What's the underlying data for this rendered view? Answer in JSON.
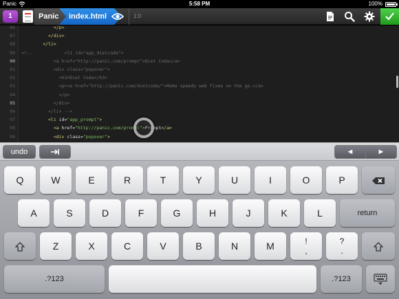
{
  "status_bar": {
    "carrier": "Panic",
    "time": "5:58 PM",
    "battery": "100%"
  },
  "toolbar": {
    "badge": "1",
    "site_name": "Panic",
    "file_name": "index.html",
    "cursor_position": "1:0",
    "accent_color": "#1a6fd1",
    "commit_color": "#2eb82b"
  },
  "editor": {
    "lines": [
      {
        "num": "86",
        "active": false,
        "indent": 12,
        "tokens": [
          [
            "tag",
            "</p>"
          ]
        ]
      },
      {
        "num": "87",
        "active": false,
        "indent": 10,
        "tokens": [
          [
            "tag",
            "</div>"
          ]
        ]
      },
      {
        "num": "88",
        "active": false,
        "indent": 8,
        "tokens": [
          [
            "tag",
            "</li>"
          ]
        ]
      },
      {
        "num": "89",
        "active": false,
        "indent": 0,
        "tokens": [
          [
            "cmt",
            "<!--"
          ],
          [
            "cmt",
            "            <li id=\"app_dietcoda\">"
          ]
        ]
      },
      {
        "num": "90",
        "active": true,
        "indent": 12,
        "tokens": [
          [
            "cmt",
            "<a href=\"http://panic.com/prompt\">Diet Coda</a>"
          ]
        ]
      },
      {
        "num": "91",
        "active": false,
        "indent": 12,
        "tokens": [
          [
            "cmt",
            "<div class=\"popover\">"
          ]
        ]
      },
      {
        "num": "92",
        "active": false,
        "indent": 14,
        "tokens": [
          [
            "cmt",
            "<h3>Diet Coda</h3>"
          ]
        ]
      },
      {
        "num": "93",
        "active": false,
        "indent": 14,
        "tokens": [
          [
            "cmt",
            "<p><a href=\"http://panic.com/dietcoda/\">Make speedy web fixes on the go.</a>"
          ]
        ]
      },
      {
        "num": "94",
        "active": false,
        "indent": 14,
        "tokens": [
          [
            "cmt",
            "</p>"
          ]
        ]
      },
      {
        "num": "95",
        "active": true,
        "indent": 12,
        "tokens": [
          [
            "cmt",
            "</div>"
          ]
        ]
      },
      {
        "num": "96",
        "active": false,
        "indent": 10,
        "tokens": [
          [
            "cmt",
            "</li> -->"
          ]
        ]
      },
      {
        "num": "97",
        "active": false,
        "indent": 10,
        "tokens": [
          [
            "tag",
            "<li "
          ],
          [
            "attr",
            "id="
          ],
          [
            "str",
            "\"app_prompt\""
          ],
          [
            "tag",
            ">"
          ]
        ]
      },
      {
        "num": "98",
        "active": false,
        "indent": 12,
        "tokens": [
          [
            "tag",
            "<a "
          ],
          [
            "attr",
            "href="
          ],
          [
            "str",
            "\"http://panic.com/prompt\""
          ],
          [
            "tag",
            ">"
          ],
          [
            "attr",
            "Prompt"
          ],
          [
            "tag",
            "</a>"
          ]
        ]
      },
      {
        "num": "99",
        "active": false,
        "indent": 12,
        "tokens": [
          [
            "tag",
            "<div "
          ],
          [
            "attr",
            "class="
          ],
          [
            "str",
            "\"popover\""
          ],
          [
            "tag",
            ">"
          ]
        ]
      }
    ]
  },
  "accessory": {
    "undo": "undo",
    "left_arrow": "◄",
    "right_arrow": "►"
  },
  "keyboard": {
    "row1": [
      "Q",
      "W",
      "E",
      "R",
      "T",
      "Y",
      "U",
      "I",
      "O",
      "P"
    ],
    "row2": [
      "A",
      "S",
      "D",
      "F",
      "G",
      "H",
      "J",
      "K",
      "L"
    ],
    "row3": [
      "Z",
      "X",
      "C",
      "V",
      "B",
      "N",
      "M"
    ],
    "return": "return",
    "numbers": ".?123",
    "punct1": [
      "!",
      ","
    ],
    "punct2": [
      "?",
      "."
    ]
  }
}
